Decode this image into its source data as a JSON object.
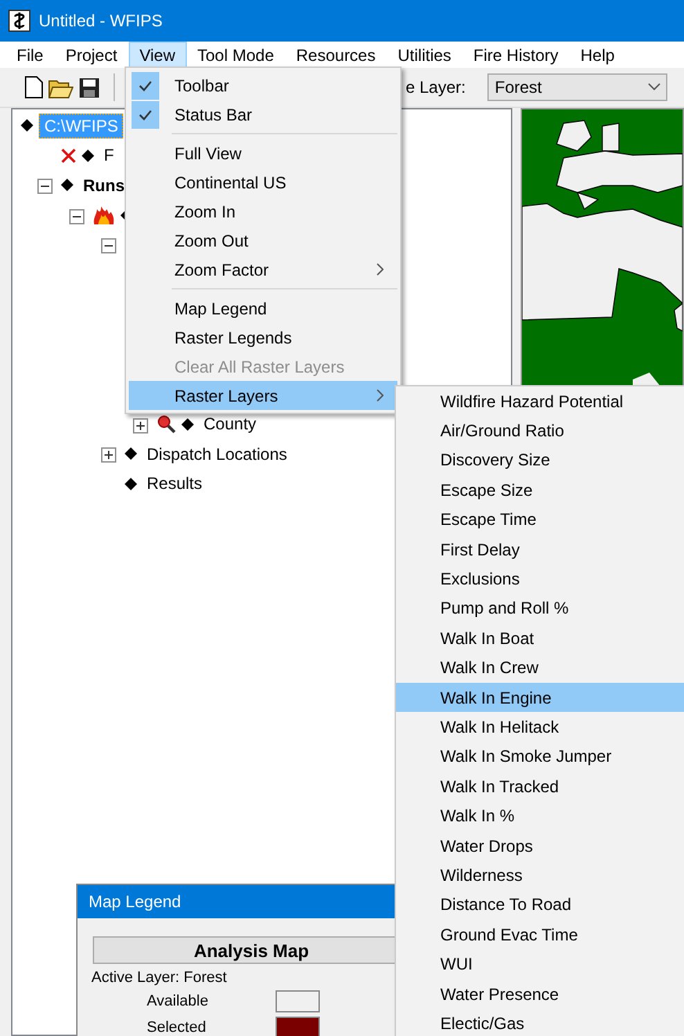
{
  "window": {
    "title": "Untitled - WFIPS"
  },
  "menu_bar": [
    {
      "label": "File",
      "selected": false
    },
    {
      "label": "Project",
      "selected": false
    },
    {
      "label": "View",
      "selected": true
    },
    {
      "label": "Tool Mode",
      "selected": false
    },
    {
      "label": "Resources",
      "selected": false
    },
    {
      "label": "Utilities",
      "selected": false
    },
    {
      "label": "Fire History",
      "selected": false
    },
    {
      "label": "Help",
      "selected": false
    }
  ],
  "toolbar": {
    "layer_label": "e Layer:",
    "layer_dropdown": "Forest"
  },
  "tree": [
    {
      "label": "C:\\WFIPS",
      "selected": true,
      "children": [
        {
          "label": "F",
          "kind": "excluded",
          "selected": false
        },
        {
          "label": "Runs",
          "kind": "group",
          "selected": false,
          "expanded": true,
          "children": [
            {
              "kind": "run",
              "expanded": true,
              "children": [
                {
                  "expanded": true,
                  "children": [
                    {
                      "label": "County",
                      "kind": "query",
                      "selected": false,
                      "expanded": false
                    }
                  ]
                },
                {
                  "label": "Dispatch Locations",
                  "selected": false,
                  "expanded": false
                },
                {
                  "label": "Results",
                  "selected": false
                }
              ]
            }
          ]
        }
      ]
    }
  ],
  "view_menu": [
    {
      "kind": "item",
      "label": "Toolbar",
      "checked": true,
      "disabled": false,
      "submenu": false,
      "selected": false
    },
    {
      "kind": "item",
      "label": "Status Bar",
      "checked": true,
      "disabled": false,
      "submenu": false,
      "selected": false
    },
    {
      "kind": "separator"
    },
    {
      "kind": "item",
      "label": "Full View",
      "checked": false,
      "disabled": false,
      "submenu": false,
      "selected": false
    },
    {
      "kind": "item",
      "label": "Continental US",
      "checked": false,
      "disabled": false,
      "submenu": false,
      "selected": false
    },
    {
      "kind": "item",
      "label": "Zoom In",
      "checked": false,
      "disabled": false,
      "submenu": false,
      "selected": false
    },
    {
      "kind": "item",
      "label": "Zoom Out",
      "checked": false,
      "disabled": false,
      "submenu": false,
      "selected": false
    },
    {
      "kind": "item",
      "label": "Zoom Factor",
      "checked": false,
      "disabled": false,
      "submenu": true,
      "selected": false
    },
    {
      "kind": "separator"
    },
    {
      "kind": "item",
      "label": "Map Legend",
      "checked": false,
      "disabled": false,
      "submenu": false,
      "selected": false
    },
    {
      "kind": "item",
      "label": "Raster Legends",
      "checked": false,
      "disabled": false,
      "submenu": false,
      "selected": false
    },
    {
      "kind": "item",
      "label": "Clear All Raster Layers",
      "checked": false,
      "disabled": true,
      "submenu": false,
      "selected": false
    },
    {
      "kind": "item",
      "label": "Raster Layers",
      "checked": false,
      "disabled": false,
      "submenu": true,
      "selected": true
    }
  ],
  "raster_layers_menu": [
    {
      "label": "Wildfire Hazard Potential",
      "selected": false
    },
    {
      "label": "Air/Ground Ratio",
      "selected": false
    },
    {
      "label": "Discovery Size",
      "selected": false
    },
    {
      "label": "Escape Size",
      "selected": false
    },
    {
      "label": "Escape Time",
      "selected": false
    },
    {
      "label": "First Delay",
      "selected": false
    },
    {
      "label": "Exclusions",
      "selected": false
    },
    {
      "label": "Pump and Roll %",
      "selected": false
    },
    {
      "label": "Walk In Boat",
      "selected": false
    },
    {
      "label": "Walk In Crew",
      "selected": false
    },
    {
      "label": "Walk In Engine",
      "selected": true
    },
    {
      "label": "Walk In Helitack",
      "selected": false
    },
    {
      "label": "Walk In Smoke Jumper",
      "selected": false
    },
    {
      "label": "Walk In Tracked",
      "selected": false
    },
    {
      "label": "Walk In %",
      "selected": false
    },
    {
      "label": "Water Drops",
      "selected": false
    },
    {
      "label": "Wilderness",
      "selected": false
    },
    {
      "label": "Distance To Road",
      "selected": false
    },
    {
      "label": "Ground Evac Time",
      "selected": false
    },
    {
      "label": "WUI",
      "selected": false
    },
    {
      "label": "Water Presence",
      "selected": false
    },
    {
      "label": "Electic/Gas",
      "selected": false
    }
  ],
  "map_legend": {
    "title": "Map Legend",
    "header": "Analysis Map",
    "active_layer": "Active Layer: Forest",
    "entries": [
      {
        "label": "Available",
        "color": "#f0f0f0"
      },
      {
        "label": "Selected",
        "color": "#7a0000"
      }
    ]
  }
}
